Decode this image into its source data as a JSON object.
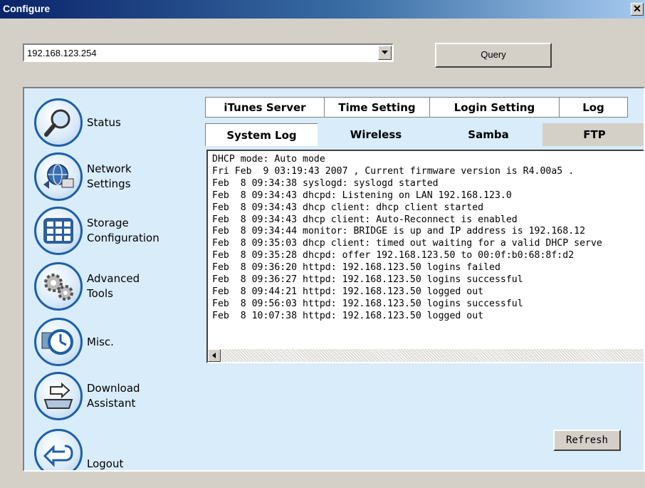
{
  "window": {
    "title": "Configure",
    "close_glyph": "✕"
  },
  "address_bar": {
    "value": "192.168.123.254",
    "query_label": "Query"
  },
  "sidebar": {
    "items": [
      {
        "label_line1": "Status",
        "label_line2": "",
        "icon": "magnifier-icon"
      },
      {
        "label_line1": "Network",
        "label_line2": "Settings",
        "icon": "network-globe-icon"
      },
      {
        "label_line1": "Storage",
        "label_line2": "Configuration",
        "icon": "storage-grid-icon"
      },
      {
        "label_line1": "Advanced",
        "label_line2": "Tools",
        "icon": "gears-icon"
      },
      {
        "label_line1": "Misc.",
        "label_line2": "",
        "icon": "clock-icon"
      },
      {
        "label_line1": "Download",
        "label_line2": "Assistant",
        "icon": "download-tray-icon"
      },
      {
        "label_line1": "Logout",
        "label_line2": "",
        "icon": "logout-arrow-icon"
      }
    ]
  },
  "tabs": {
    "top": [
      "iTunes Server",
      "Time Setting",
      "Login Setting",
      "Log"
    ],
    "sub": [
      "System Log",
      "Wireless",
      "Samba",
      "FTP"
    ],
    "active_sub": "System Log"
  },
  "log": {
    "lines": [
      "DHCP mode: Auto mode",
      "Fri Feb  9 03:19:43 2007 , Current firmware version is R4.00a5 .",
      "",
      "Feb  8 09:34:38 syslogd: syslogd started",
      "Feb  8 09:34:43 dhcpd: Listening on LAN 192.168.123.0",
      "Feb  8 09:34:43 dhcp client: dhcp client started",
      "Feb  8 09:34:43 dhcp client: Auto-Reconnect is enabled",
      "Feb  8 09:34:44 monitor: BRIDGE is up and IP address is 192.168.12",
      "Feb  8 09:35:03 dhcp client: timed out waiting for a valid DHCP serve",
      "Feb  8 09:35:28 dhcpd: offer 192.168.123.50 to 00:0f:b0:68:8f:d2",
      "Feb  8 09:36:20 httpd: 192.168.123.50 logins failed",
      "Feb  8 09:36:27 httpd: 192.168.123.50 logins successful",
      "Feb  8 09:44:21 httpd: 192.168.123.50 logged out",
      "Feb  8 09:56:03 httpd: 192.168.123.50 logins successful",
      "Feb  8 10:07:38 httpd: 192.168.123.50 logged out"
    ]
  },
  "refresh_label": "Refresh",
  "colors": {
    "panel_bg": "#d8ecfa",
    "title_start": "#0a246a",
    "icon_ring": "#1d5fa8"
  }
}
